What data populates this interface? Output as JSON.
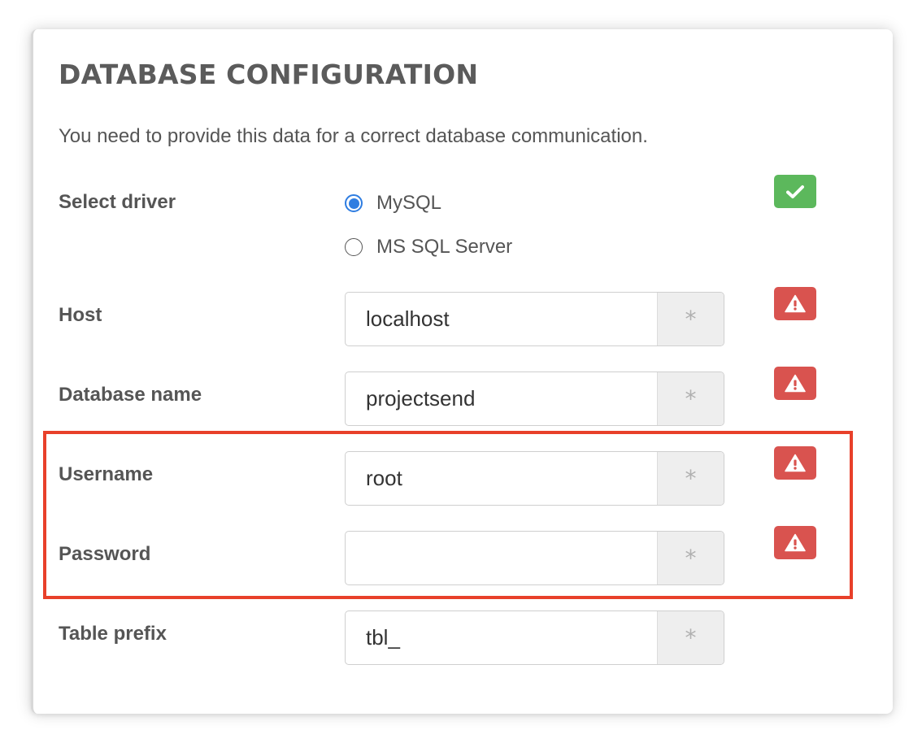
{
  "title": "DATABASE CONFIGURATION",
  "description": "You need to provide this data for a correct database communication.",
  "driver": {
    "label": "Select driver",
    "options": [
      {
        "label": "MySQL",
        "selected": true
      },
      {
        "label": "MS SQL Server",
        "selected": false
      }
    ],
    "status": "success"
  },
  "fields": {
    "host": {
      "label": "Host",
      "value": "localhost",
      "addon": "*",
      "status": "warning"
    },
    "database_name": {
      "label": "Database name",
      "value": "projectsend",
      "addon": "*",
      "status": "warning"
    },
    "username": {
      "label": "Username",
      "value": "root",
      "addon": "*",
      "status": "warning"
    },
    "password": {
      "label": "Password",
      "value": "",
      "addon": "*",
      "status": "warning"
    },
    "table_prefix": {
      "label": "Table prefix",
      "value": "tbl_",
      "addon": "*"
    }
  },
  "colors": {
    "success": "#5cb85c",
    "warning": "#d9534f",
    "radio_accent": "#2f7de1",
    "highlight_box": "#e8402a"
  },
  "icons": {
    "success": "check-icon",
    "warning": "warning-triangle-icon"
  }
}
